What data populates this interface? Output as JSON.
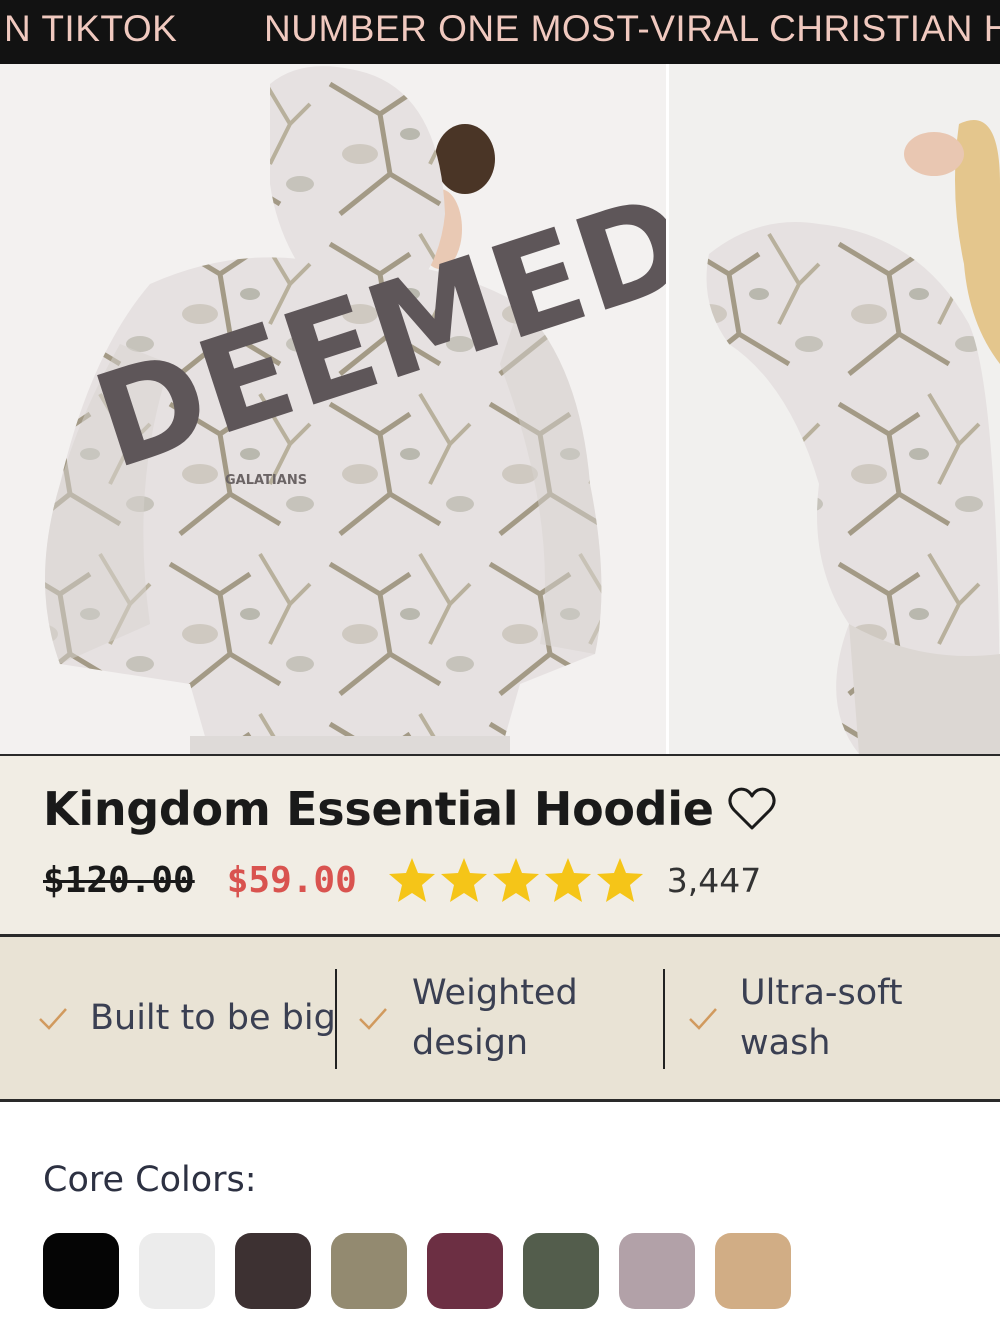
{
  "announcement_bar": {
    "items": [
      "N TIKTOK",
      "NUMBER ONE MOST-VIRAL CHRISTIAN H"
    ],
    "background": "#121212",
    "text_color": "#f0c9bf"
  },
  "gallery": {
    "main_image": {
      "print_text": "DEEMED",
      "small_print": "GALATIANS"
    }
  },
  "product": {
    "title": "Kingdom Essential Hoodie",
    "compare_price": "$120.00",
    "sale_price": "$59.00",
    "sale_color": "#d9534f",
    "rating": 5,
    "review_count": "3,447",
    "wishlist_icon": "heart-outline-icon"
  },
  "features": [
    {
      "icon": "check-icon",
      "label": "Built to be big"
    },
    {
      "icon": "check-icon",
      "label": "Weighted design"
    },
    {
      "icon": "check-icon",
      "label": "Ultra-soft wash"
    }
  ],
  "colors": {
    "title": "Core Colors:",
    "swatches": [
      "#050505",
      "#ececec",
      "#3d3132",
      "#938a70",
      "#6c2f43",
      "#535d4c",
      "#b2a1a8",
      "#d1ad85"
    ]
  }
}
